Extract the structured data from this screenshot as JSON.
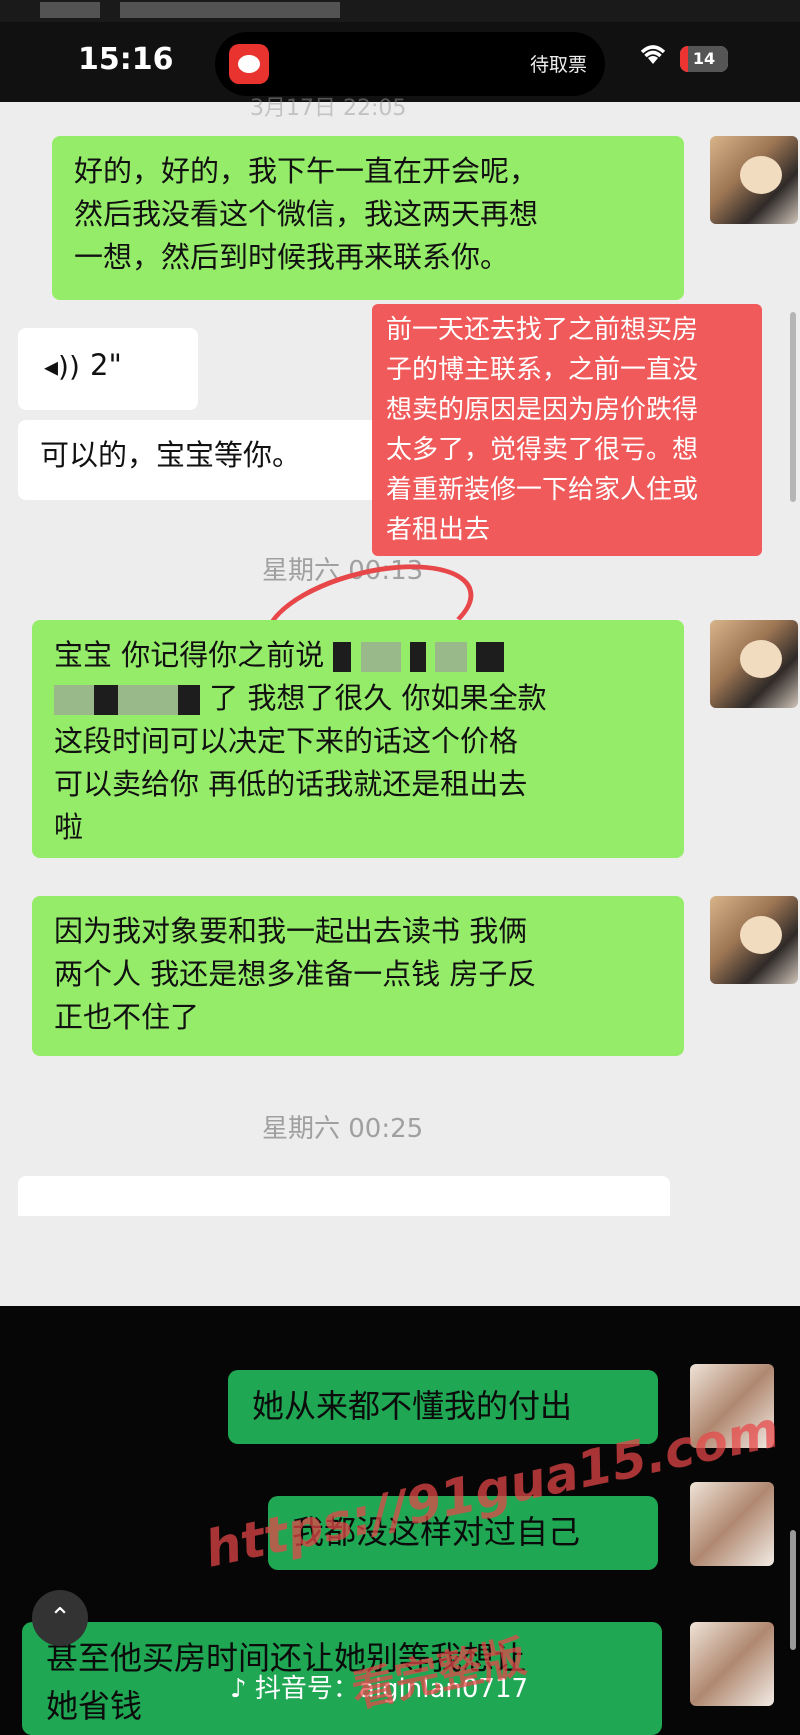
{
  "status_bar": {
    "time": "15:16",
    "island_text": "待取票",
    "battery": "14"
  },
  "chat": {
    "message1": {
      "lines": [
        "好的，好的，我下午一直在开会呢，",
        "然后我没看这个微信，我这两天再想",
        "一想，然后到时候我再来联系你。"
      ]
    },
    "voice_duration": "2\"",
    "message2": "可以的，宝宝等你。",
    "annotation": [
      "前一天还去找了之前想买房",
      "子的博主联系，之前一直没",
      "想卖的原因是因为房价跌得",
      "太多了，觉得卖了很亏。想",
      "着重新装修一下给家人住或",
      "者租出去"
    ],
    "timestamp1": "星期六 00:13",
    "message3": {
      "line1": "宝宝 你记得你之前说",
      "line2_end": "了 我想了很久 你如果全款",
      "line3": "这段时间可以决定下来的话这个价格",
      "line4": "可以卖给你 再低的话我就还是租出去",
      "line5": "啦"
    },
    "message4": [
      "因为我对象要和我一起出去读书 我俩",
      "两个人 我还是想多准备一点钱 房子反",
      "正也不住了"
    ],
    "timestamp2": "星期六 00:25"
  },
  "overlay": {
    "msg1": "她从来都不懂我的付出",
    "msg2": "我都没这样对过自己",
    "msg3_line1": "甚至他买房时间还让她别等我想让",
    "msg3_line2": "她省钱",
    "douyin_label": "抖音号",
    "douyin_id": "aiginlan0717"
  },
  "watermark": {
    "url": "https://91gua15.com",
    "text": "看完整版"
  }
}
